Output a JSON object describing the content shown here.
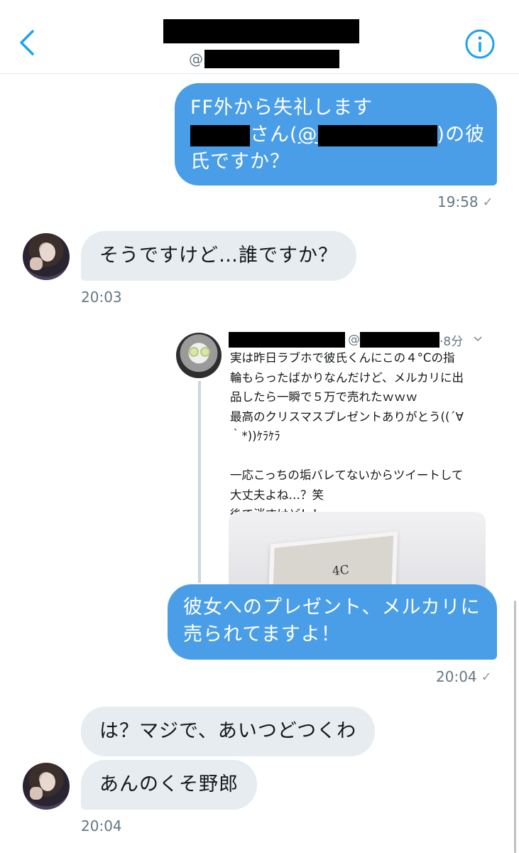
{
  "header": {
    "handle_prefix": "@"
  },
  "icons": {
    "back": "chevron-left-icon",
    "info": "info-icon"
  },
  "colors": {
    "accent": "#1da1f2",
    "outgoing_bubble": "#4a9ee8",
    "incoming_bubble": "#e6ecf0"
  },
  "messages": [
    {
      "direction": "outgoing",
      "line1": "FF外から失礼します",
      "line2_mid": "さん(",
      "line2_at": "@",
      "line2_end": ")の彼",
      "line3": "氏ですか？",
      "time": "19:58",
      "check": "✓"
    },
    {
      "direction": "incoming",
      "text": "そうですけど…誰ですか？",
      "time": "20:03"
    },
    {
      "direction": "outgoing",
      "quoted_tweet": {
        "handle_prefix": "@",
        "age": "·8分",
        "text": "実は昨日ラブホで彼氏くんにこの４°Cの指\n輪もらったばかりなんだけど、メルカリに出\n品したら一瞬で５万で売れたｗｗｗ\n最高のクリスマスプレゼントありがとう((´∀\n｀*))ｹﾗｹﾗ\n\n一応こっちの垢バレてないからツイートして\n大丈夫よね…？笑\n後で消すけど！！",
        "image_label": "4C"
      },
      "line1": "彼女へのプレゼント、メルカリに",
      "line2": "売られてますよ！",
      "time": "20:04",
      "check": "✓"
    },
    {
      "direction": "incoming",
      "text": "は？マジで、あいつどつくわ"
    },
    {
      "direction": "incoming",
      "text": "あんのくそ野郎",
      "time": "20:04"
    }
  ]
}
